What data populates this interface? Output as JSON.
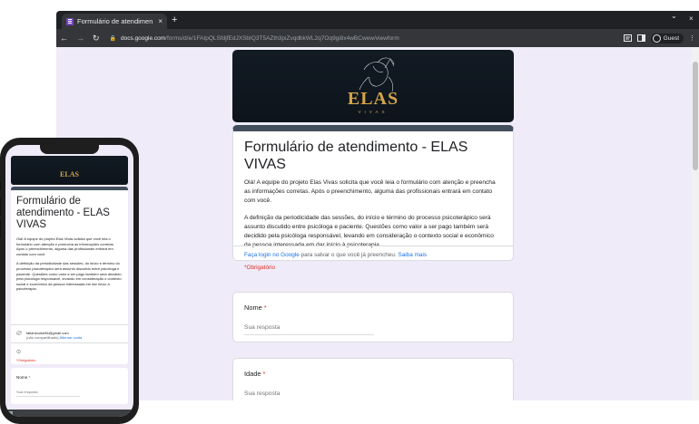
{
  "browser": {
    "tab_title": "Formulário de atendimen",
    "tab_close": "×",
    "new_tab": "+",
    "window_chevron": "⌄",
    "window_close": "×",
    "url_host": "docs.google.com",
    "url_path": "/forms/d/e/1FAIpQLSfdjfEdJXSbIQ3T5AZth3piZvqdbkWL2q7Oq9gi8x4wBCwew/viewform",
    "profile_label": "Guest",
    "menu": "⋮"
  },
  "form": {
    "brand_word": "ELAS",
    "brand_sub": "VIVAS",
    "title": "Formulário de atendimento - ELAS VIVAS",
    "desc_p1": "Olá! A equipe do projeto Elas Vivas solicita que você leia o formulário com atenção e preencha as informações corretas. Após o preenchimento, alguma das profissionais entrará em contato com você.",
    "desc_p2": "A definição da periodicidade das sessões, do início e término do processo psicoterápico será assunto discutido entre psicóloga e paciente. Questões como valor a ser pago também será decidido pela psicóloga responsável, levando em consideração o contexto social e econômico da pessoa interessada em dar início à psicoterapia.",
    "login_link": "Faça login no Google",
    "login_text": " para salvar o que você já preencheu. ",
    "learn_more": "Saiba mais",
    "required_note": "*Obrigatório",
    "questions": [
      {
        "label": "Nome",
        "star": " *",
        "placeholder": "Sua resposta"
      },
      {
        "label": "Idade",
        "star": " *",
        "placeholder": "Sua resposta"
      }
    ]
  },
  "phone": {
    "brand_word": "ELAS",
    "title": "Formulário de atendimento - ELAS VIVAS",
    "desc_p1": "Olá! A equipe do projeto Elas Vivas solicita que você leia o formulário com atenção e preencha as informações corretas. Após o preenchimento, alguma das profissionais entrará em contato com você.",
    "desc_p2": "A definição da periodicidade das sessões, do início e término do processo psicoterápico será assunto discutido entre psicóloga e paciente. Questões como valor a ser pago também será decidido pela psicóloga responsável, levando em consideração o contexto social e econômico da pessoa interessada em dar início à psicoterapia.",
    "account_email": "tallanlouise06@gmail.com",
    "account_note": "(não compartilhado) ",
    "switch_account": "Alternar conta",
    "required_note": "*Obrigatório",
    "question_label": "Nome",
    "question_star": " *",
    "question_placeholder": "Sua resposta"
  },
  "colors": {
    "accent": "#424e5c",
    "page_bg": "#f0ebf8",
    "brand_gold": "#d4a44a",
    "required_red": "#d93025",
    "link_blue": "#1a73e8"
  }
}
